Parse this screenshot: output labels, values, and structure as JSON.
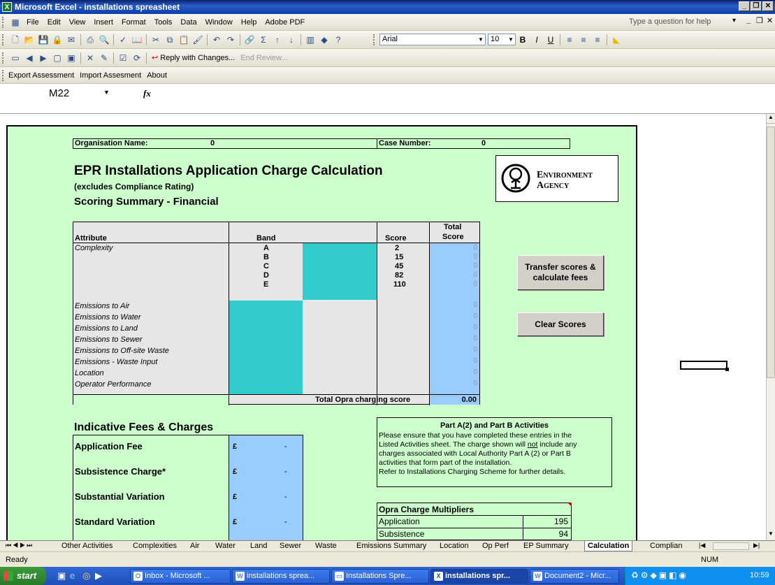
{
  "window": {
    "title": "Microsoft Excel - installations spreasheet"
  },
  "menu": {
    "items": [
      "File",
      "Edit",
      "View",
      "Insert",
      "Format",
      "Tools",
      "Data",
      "Window",
      "Help",
      "Adobe PDF"
    ],
    "help_placeholder": "Type a question for help"
  },
  "format_toolbar": {
    "font": "Arial",
    "size": "10"
  },
  "review_toolbar": {
    "reply": "Reply with Changes...",
    "end_review": "End Review..."
  },
  "custom_toolbar": {
    "export": "Export Assessment",
    "import": "Import Assesment",
    "about": "About"
  },
  "formula_bar": {
    "name_box": "M22",
    "fx": "fx",
    "content": ""
  },
  "sheet": {
    "org_label": "Organisation Name:",
    "org_value": "0",
    "case_label": "Case Number:",
    "case_value": "0",
    "title": "EPR Installations Application Charge Calculation",
    "subtitle": "(excludes Compliance Rating)",
    "section": "Scoring Summary - Financial",
    "logo_line1": "Environment",
    "logo_line2": "Agency",
    "table": {
      "headers": {
        "attribute": "Attribute",
        "band": "Band",
        "score": "Score",
        "total_line1": "Total",
        "total_line2": "Score"
      },
      "complexity_label": "Complexity",
      "bands": [
        {
          "band": "A",
          "score": "2"
        },
        {
          "band": "B",
          "score": "15"
        },
        {
          "band": "C",
          "score": "45"
        },
        {
          "band": "D",
          "score": "82"
        },
        {
          "band": "E",
          "score": "110"
        }
      ],
      "attributes": [
        "Emissions to Air",
        "Emissions to Water",
        "Emissions to Land",
        "Emissions to Sewer",
        "Emissions to Off-site Waste",
        "Emissions - Waste Input",
        "Location",
        "Operator Performance"
      ],
      "total_scores": [
        "0",
        "0",
        "0",
        "0",
        "0",
        "0",
        "0",
        "0",
        "0",
        "0",
        "0",
        "0",
        "0"
      ],
      "total_label": "Total Opra charging score",
      "total_value": "0.00"
    },
    "buttons": {
      "transfer_line1": "Transfer scores &",
      "transfer_line2": "calculate fees",
      "clear": "Clear Scores"
    },
    "fees": {
      "title": "Indicative Fees & Charges",
      "rows": [
        {
          "label": "Application Fee",
          "currency": "£",
          "value": "-"
        },
        {
          "label": "Subsistence Charge*",
          "currency": "£",
          "value": "-"
        },
        {
          "label": "Substantial Variation",
          "currency": "£",
          "value": "-"
        },
        {
          "label": "Standard Variation",
          "currency": "£",
          "value": "-"
        }
      ]
    },
    "part_a": {
      "title": "Part A(2) and Part B Activities",
      "line1": "Please ensure that you have completed these entries in the",
      "line2a": "Listed Activities sheet. The charge shown will ",
      "line2u": "not",
      "line2b": " include any",
      "line3": "charges associated with Local Authority Part A (2) or Part B",
      "line4": "activities that form part of the installation.",
      "line5": "Refer to Installations Charging Scheme for further details."
    },
    "multipliers": {
      "title": "Opra Charge Multipliers",
      "rows": [
        {
          "label": "Application",
          "value": "195"
        },
        {
          "label": "Subsistence",
          "value": "94"
        }
      ]
    }
  },
  "tabs": [
    "Other Activities",
    "Complexities",
    "Air",
    "Water",
    "Land",
    "Sewer",
    "Waste",
    "Emissions Summary",
    "Location",
    "Op Perf",
    "EP Summary",
    "Calculation",
    "Complian"
  ],
  "active_tab": "Calculation",
  "status": {
    "text": "Ready",
    "num": "NUM"
  },
  "taskbar": {
    "start": "start",
    "items": [
      "Inbox - Microsoft ...",
      "installations sprea...",
      "Installations Spre...",
      "installations spr...",
      "Document2 - Micr..."
    ],
    "clock": "10:59"
  }
}
